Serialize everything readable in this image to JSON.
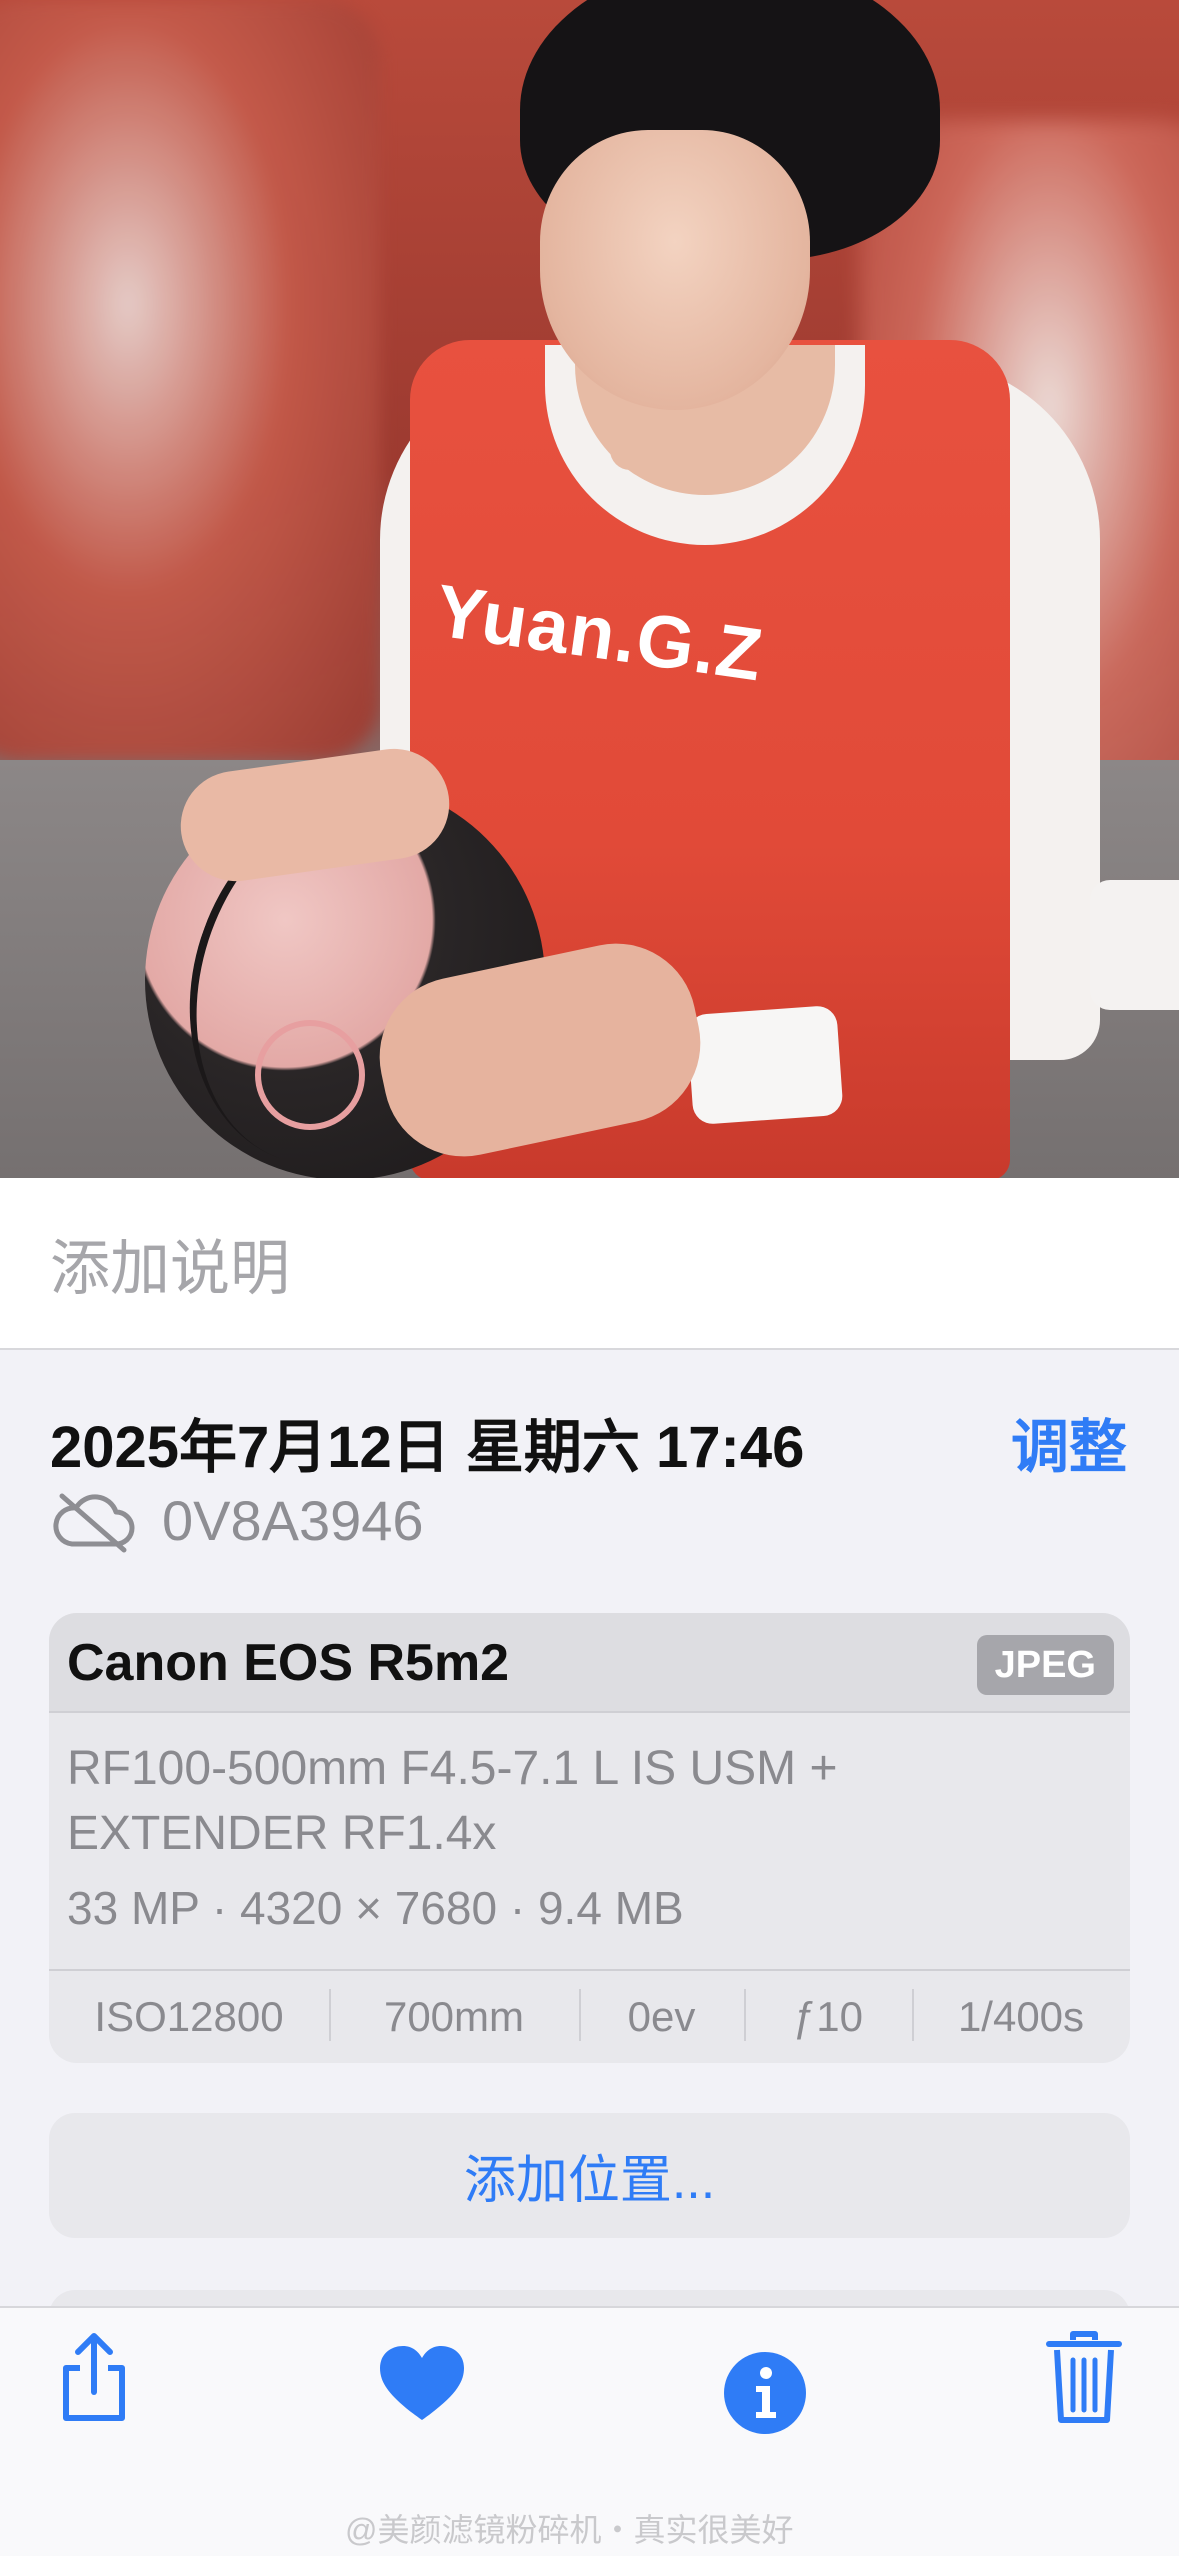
{
  "photo": {
    "jersey_text": "Yuan.G.Z"
  },
  "caption": {
    "placeholder": "添加说明"
  },
  "info": {
    "datetime": "2025年7月12日 星期六 17:46",
    "adjust_label": "调整",
    "filename": "0V8A3946",
    "cloud_icon": "cloud-slash-icon"
  },
  "camera_card": {
    "camera": "Canon EOS R5m2",
    "format_badge": "JPEG",
    "lens_line1": "RF100-500mm F4.5-7.1 L IS USM +",
    "lens_line2": "EXTENDER RF1.4x",
    "specs": "33 MP · 4320 × 7680 · 9.4 MB",
    "exif": [
      "ISO12800",
      "700mm",
      "0ev",
      "ƒ10",
      "1/400s"
    ]
  },
  "location": {
    "label": "添加位置..."
  },
  "toolbar": {
    "share_icon": "share-icon",
    "favorite_icon": "heart-icon",
    "info_icon": "info-icon",
    "delete_icon": "trash-icon",
    "accent": "#2f7cf6"
  },
  "watermark": {
    "text": "@美颜滤镜粉碎机・真实很美好"
  }
}
